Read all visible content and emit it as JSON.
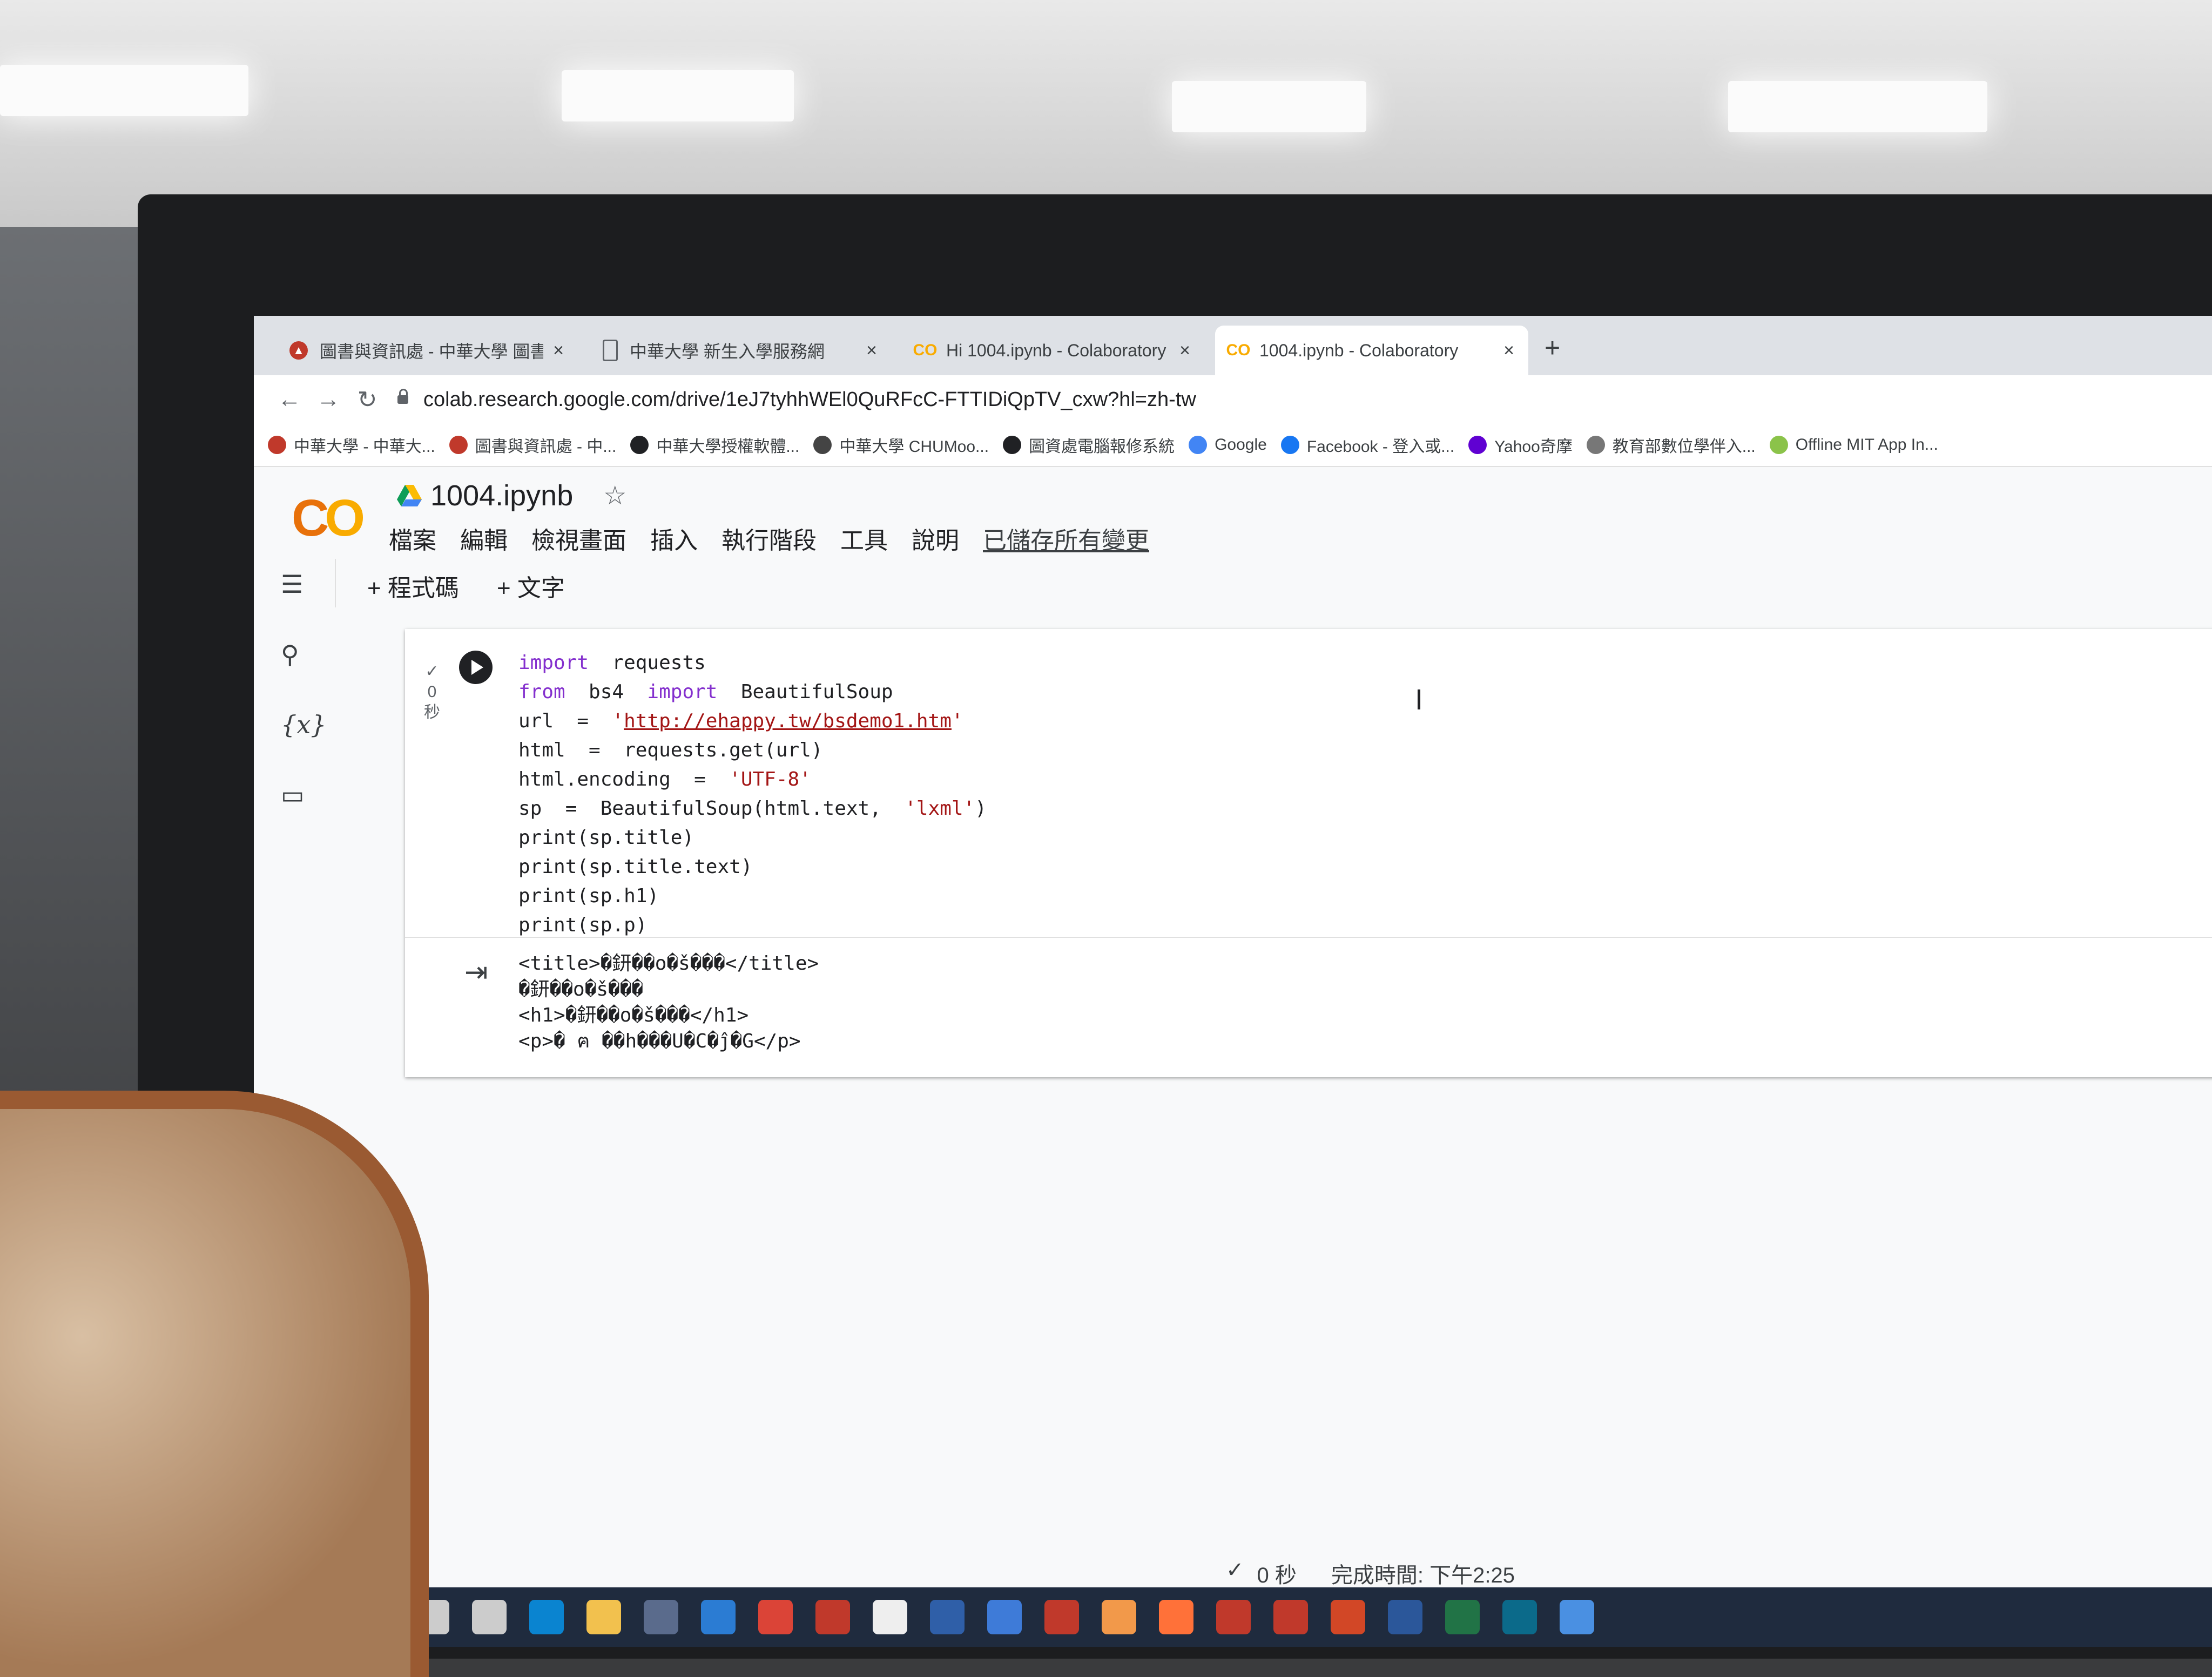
{
  "tabs": [
    {
      "title": "圖書與資訊處 - 中華大學 圖書與",
      "icon": "library-icon",
      "active": false
    },
    {
      "title": "中華大學 新生入學服務網",
      "icon": "doc-icon",
      "active": false
    },
    {
      "title": "Hi 1004.ipynb - Colaboratory",
      "icon": "colab-icon",
      "active": false
    },
    {
      "title": "1004.ipynb - Colaboratory",
      "icon": "colab-icon",
      "active": true
    }
  ],
  "url": "colab.research.google.com/drive/1eJ7tyhhWEl0QuRFcC-FTTIDiQpTV_cxw?hl=zh-tw",
  "bookmarks": [
    {
      "label": "中華大學 - 中華大...",
      "icon": "chu-icon",
      "color": "#c0392b"
    },
    {
      "label": "圖書與資訊處 - 中...",
      "icon": "library-icon",
      "color": "#c0392b"
    },
    {
      "label": "中華大學授權軟體...",
      "icon": "globe-icon",
      "color": "#202124"
    },
    {
      "label": "中華大學 CHUMoo...",
      "icon": "m-icon",
      "color": "#444"
    },
    {
      "label": "圖資處電腦報修系統",
      "icon": "globe-icon",
      "color": "#202124"
    },
    {
      "label": "Google",
      "icon": "google-icon",
      "color": "#4285f4"
    },
    {
      "label": "Facebook - 登入或...",
      "icon": "facebook-icon",
      "color": "#1877f2"
    },
    {
      "label": "Yahoo奇摩",
      "icon": "yahoo-icon",
      "color": "#6001d2"
    },
    {
      "label": "教育部數位學伴入...",
      "icon": "gear-icon",
      "color": "#777"
    },
    {
      "label": "Offline MIT App In...",
      "icon": "mit-icon",
      "color": "#8bc34a"
    }
  ],
  "notebook": {
    "title": "1004.ipynb",
    "menu": [
      "檔案",
      "編輯",
      "檢視畫面",
      "插入",
      "執行階段",
      "工具",
      "說明"
    ],
    "saved_status": "已儲存所有變更",
    "add_code": "+ 程式碼",
    "add_text": "+ 文字"
  },
  "cell": {
    "exec_check": "✓",
    "exec_time": "0",
    "exec_unit": "秒",
    "code_lines": [
      {
        "tokens": [
          {
            "t": "import",
            "c": "kw"
          },
          {
            "t": "  requests",
            "c": ""
          }
        ]
      },
      {
        "tokens": [
          {
            "t": "from",
            "c": "kw"
          },
          {
            "t": "  bs4  ",
            "c": ""
          },
          {
            "t": "import",
            "c": "kw"
          },
          {
            "t": "  BeautifulSoup",
            "c": ""
          }
        ]
      },
      {
        "tokens": [
          {
            "t": "url  =  ",
            "c": ""
          },
          {
            "t": "'",
            "c": "str"
          },
          {
            "t": "http://ehappy.tw/bsdemo1.htm",
            "c": "link"
          },
          {
            "t": "'",
            "c": "str"
          }
        ]
      },
      {
        "tokens": [
          {
            "t": "html  =  requests.get(url)",
            "c": ""
          }
        ]
      },
      {
        "tokens": [
          {
            "t": "html.encoding  =  ",
            "c": ""
          },
          {
            "t": "'UTF-8'",
            "c": "str"
          }
        ]
      },
      {
        "tokens": [
          {
            "t": "sp  =  BeautifulSoup(html.text,  ",
            "c": ""
          },
          {
            "t": "'lxml'",
            "c": "str"
          },
          {
            "t": ")",
            "c": ""
          }
        ]
      },
      {
        "tokens": [
          {
            "t": "print(sp.title)",
            "c": ""
          }
        ]
      },
      {
        "tokens": [
          {
            "t": "print(sp.title.text)",
            "c": ""
          }
        ]
      },
      {
        "tokens": [
          {
            "t": "print(sp.h1)",
            "c": ""
          }
        ]
      },
      {
        "tokens": [
          {
            "t": "print(sp.p)",
            "c": ""
          }
        ]
      }
    ],
    "output_lines": [
      "<title>�鈃��o�š���</title>",
      "�鈃��o�š���",
      "<h1>�鈃��o�š���</h1>",
      "<p>� ฅ ��h���U�C�ĵ�G</p>"
    ]
  },
  "status": {
    "check": "✓",
    "duration": "0 秒",
    "completed": "完成時間: 下午2:25"
  },
  "taskbar": [
    "windows-icon",
    "search-icon",
    "taskview-icon",
    "edge-icon",
    "explorer-icon",
    "store-icon",
    "mail-icon",
    "chrome-icon",
    "app-icon",
    "app-icon",
    "cd-icon",
    "app-icon",
    "app-icon",
    "app-icon",
    "firefox-icon",
    "app-icon",
    "app-icon",
    "powerpoint-icon",
    "word-icon",
    "excel-icon",
    "app-icon",
    "app-icon"
  ]
}
